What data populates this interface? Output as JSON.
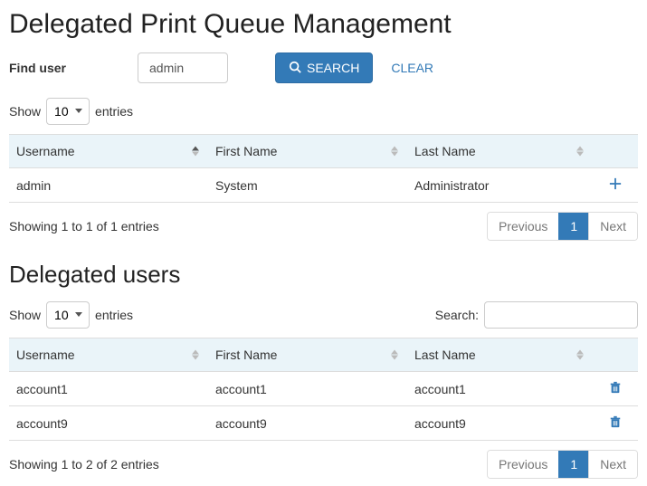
{
  "page_title": "Delegated Print Queue Management",
  "find_user": {
    "label": "Find user",
    "value": "admin",
    "search_button": "SEARCH",
    "clear_button": "CLEAR"
  },
  "table1": {
    "show_label_pre": "Show",
    "show_label_post": "entries",
    "page_length": "10",
    "columns": {
      "username": "Username",
      "first_name": "First Name",
      "last_name": "Last Name"
    },
    "rows": [
      {
        "username": "admin",
        "first_name": "System",
        "last_name": "Administrator",
        "action_icon": "plus-icon"
      }
    ],
    "info": "Showing 1 to 1 of 1 entries",
    "pagination": {
      "previous": "Previous",
      "next": "Next",
      "current": "1"
    }
  },
  "delegated_title": "Delegated users",
  "table2": {
    "show_label_pre": "Show",
    "show_label_post": "entries",
    "page_length": "10",
    "search_label": "Search:",
    "search_value": "",
    "columns": {
      "username": "Username",
      "first_name": "First Name",
      "last_name": "Last Name"
    },
    "rows": [
      {
        "username": "account1",
        "first_name": "account1",
        "last_name": "account1",
        "action_icon": "trash-icon"
      },
      {
        "username": "account9",
        "first_name": "account9",
        "last_name": "account9",
        "action_icon": "trash-icon"
      }
    ],
    "info": "Showing 1 to 2 of 2 entries",
    "pagination": {
      "previous": "Previous",
      "next": "Next",
      "current": "1"
    }
  }
}
